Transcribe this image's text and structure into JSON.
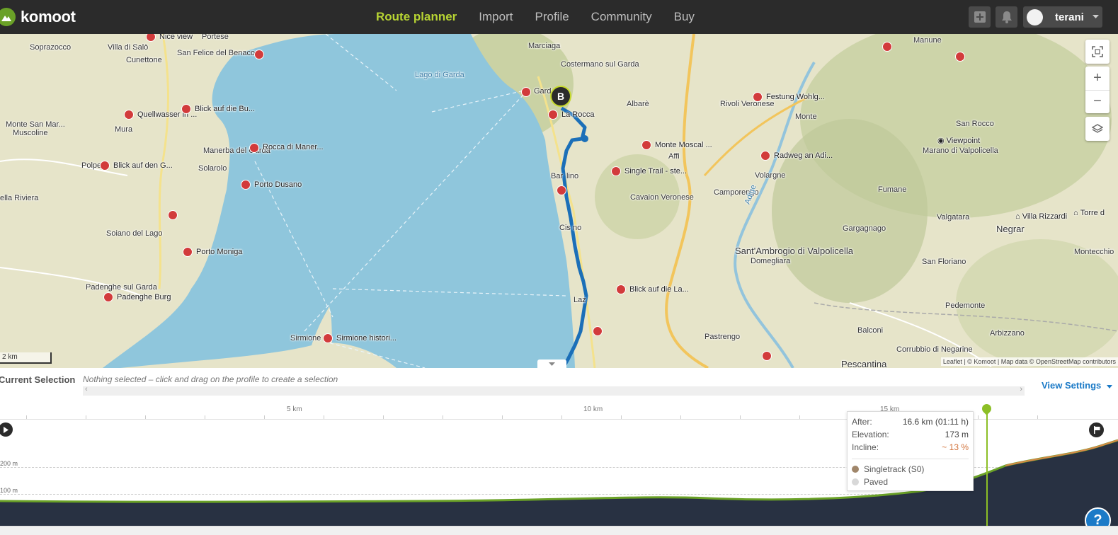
{
  "app": {
    "brand": "komoot",
    "nav": [
      {
        "label": "Route planner",
        "active": true
      },
      {
        "label": "Import"
      },
      {
        "label": "Profile"
      },
      {
        "label": "Community"
      },
      {
        "label": "Buy"
      }
    ],
    "user": {
      "name": "terani"
    }
  },
  "map": {
    "place_labels": [
      "Soprazocco",
      "Villa di Salò",
      "Portese",
      "San Felice del Benaco",
      "Cunettone",
      "Lago di Garda",
      "Marciaga",
      "Costermano sul Garda",
      "Manune",
      "Albarè",
      "Rivoli Veronese",
      "Monte",
      "Monte San Mar...",
      "Muscoline",
      "Mura",
      "Manerba del Garda",
      "Solarolo",
      "Polpe",
      "Affi",
      "Cavaion Veronese",
      "Camporengo",
      "Volargne",
      "San Rocco",
      "Marano di Valpolicella",
      "ella Riviera",
      "Fumane",
      "Valgatara",
      "Negrar",
      "Soiano del Lago",
      "Gargagnago",
      "Sant'Ambrogio di Valpolicella",
      "Domegliara",
      "San Floriano",
      "Montecchio",
      "Padenghe sul Garda",
      "Pedemonte",
      "Balconi",
      "Arbizzano",
      "Pastrengo",
      "Corrubbio di Negarine",
      "Pescantina",
      "Gard",
      "Bar",
      "lino",
      "Cis",
      "no",
      "Laz",
      "Adige",
      "Sirmione"
    ],
    "pois": [
      "Nice view",
      "Quellwasser in ...",
      "Blick auf die Bu...",
      "Rocca di Maner...",
      "Blick auf den G...",
      "Porto Dusano",
      "Porto Moniga",
      "Padenghe Burg",
      "Sirmione histori...",
      "La Rocca",
      "Festung Wohlg...",
      "Monte Moscal ...",
      "Single Trail - ste...",
      "Radweg an Adi...",
      "Blick auf die La...",
      "Viewpoint",
      "Villa Rizzardi",
      "Torre d"
    ],
    "waypoint_label": "B",
    "scale": "2 km",
    "attribution": "Leaflet | © Komoot | Map data © OpenStreetMap contributors",
    "controls": [
      "fullscreen-icon",
      "zoom-in-icon",
      "zoom-out-icon",
      "layers-icon"
    ],
    "zoom_in": "+",
    "zoom_out": "−"
  },
  "selection": {
    "title": "Current Selection",
    "hint": "Nothing selected – click and drag on the profile to create a selection",
    "view_settings": "View Settings"
  },
  "profile": {
    "km_ticks": [
      "5 km",
      "10 km",
      "15 km"
    ],
    "elevation_ticks": [
      "200 m",
      "100 m"
    ],
    "tooltip": {
      "after_label": "After:",
      "after_value": "16.6 km (01:11 h)",
      "elevation_label": "Elevation:",
      "elevation_value": "173 m",
      "incline_label": "Incline:",
      "incline_value": "~ 13 %",
      "legend": [
        {
          "label": "Singletrack (S0)",
          "color": "#a0866a"
        },
        {
          "label": "Paved",
          "color": "#d8d8d8"
        }
      ]
    },
    "help": "?"
  },
  "colors": {
    "accent": "#b7d433",
    "route": "#1b6fb8",
    "water": "#8fc6dc",
    "poi": "#d23b3b",
    "profile_fill": "#283142",
    "profile_line": "#6aa127",
    "link": "#1b7ac7"
  }
}
